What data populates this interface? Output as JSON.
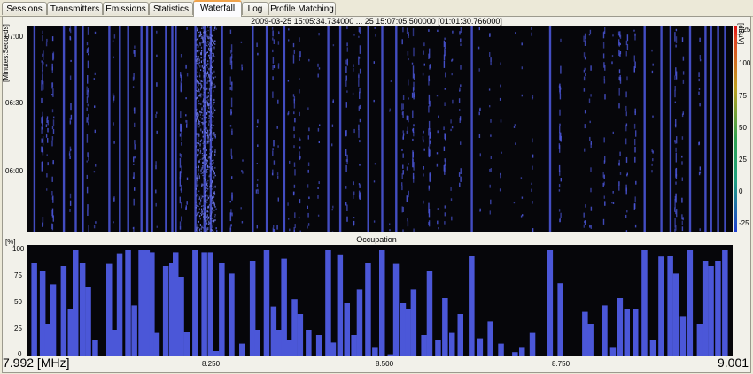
{
  "tabs": [
    {
      "label": "Sessions",
      "active": false
    },
    {
      "label": "Transmitters",
      "active": false
    },
    {
      "label": "Emissions",
      "active": false
    },
    {
      "label": "Statistics",
      "active": false
    },
    {
      "label": "Waterfall",
      "active": true
    },
    {
      "label": "Log",
      "active": false
    },
    {
      "label": "Profile Matching",
      "active": false
    }
  ],
  "waterfall": {
    "title": "2009-03-25 15:05:34.734000   ... 25 15:07:05.500000  [01:01:30.766000]",
    "y_axis_label": "[Minutes:Seconds]",
    "y_ticks": [
      "07:00",
      "06:30",
      "06:00"
    ],
    "scale_label": "[dBµV]",
    "scale_ticks": [
      "125",
      "100",
      "75",
      "50",
      "25",
      "0",
      "-25"
    ],
    "colors": {
      "background": "#06060a",
      "signal": "#4a55d6"
    }
  },
  "occupation": {
    "title": "Occupation",
    "y_axis_label": "[%]",
    "y_ticks": [
      "100",
      "75",
      "50",
      "25",
      "0"
    ],
    "x_ticks": [
      "8.250",
      "8.500",
      "8.750"
    ],
    "freq_start": "7.992 [MHz]",
    "freq_end": "9.001",
    "bar_color": "#4b57d8"
  },
  "chart_data": {
    "type": "bar",
    "title": "Occupation",
    "ylabel": "[%]",
    "xlabel": "[MHz]",
    "xlim": [
      7.992,
      9.001
    ],
    "ylim": [
      0,
      100
    ],
    "x": [
      8.003,
      8.015,
      8.022,
      8.03,
      8.045,
      8.055,
      8.062,
      8.072,
      8.08,
      8.09,
      8.11,
      8.117,
      8.125,
      8.137,
      8.146,
      8.156,
      8.164,
      8.171,
      8.178,
      8.191,
      8.2,
      8.205,
      8.213,
      8.221,
      8.233,
      8.246,
      8.255,
      8.263,
      8.271,
      8.285,
      8.3,
      8.315,
      8.322,
      8.335,
      8.345,
      8.352,
      8.36,
      8.367,
      8.375,
      8.383,
      8.395,
      8.41,
      8.423,
      8.43,
      8.44,
      8.45,
      8.46,
      8.468,
      8.48,
      8.49,
      8.5,
      8.512,
      8.52,
      8.53,
      8.537,
      8.545,
      8.56,
      8.568,
      8.58,
      8.59,
      8.6,
      8.612,
      8.628,
      8.64,
      8.655,
      8.67,
      8.69,
      8.7,
      8.715,
      8.74,
      8.755,
      8.79,
      8.798,
      8.818,
      8.83,
      8.84,
      8.85,
      8.862,
      8.875,
      8.887,
      8.899,
      8.912,
      8.92,
      8.93,
      8.94,
      8.954,
      8.962,
      8.97,
      8.98,
      8.99
    ],
    "values": [
      88,
      80,
      30,
      68,
      85,
      45,
      100,
      88,
      65,
      15,
      87,
      25,
      97,
      100,
      48,
      100,
      100,
      98,
      22,
      85,
      88,
      98,
      75,
      23,
      100,
      98,
      98,
      5,
      88,
      78,
      12,
      90,
      25,
      100,
      47,
      25,
      92,
      15,
      54,
      40,
      25,
      20,
      100,
      13,
      96,
      50,
      20,
      63,
      88,
      8,
      100,
      2,
      87,
      50,
      45,
      63,
      20,
      80,
      15,
      55,
      22,
      40,
      95,
      17,
      33,
      12,
      4,
      8,
      22,
      100,
      69,
      42,
      30,
      48,
      8,
      55,
      45,
      45,
      100,
      15,
      94,
      95,
      78,
      38,
      100,
      30,
      90,
      85,
      90,
      100
    ]
  }
}
